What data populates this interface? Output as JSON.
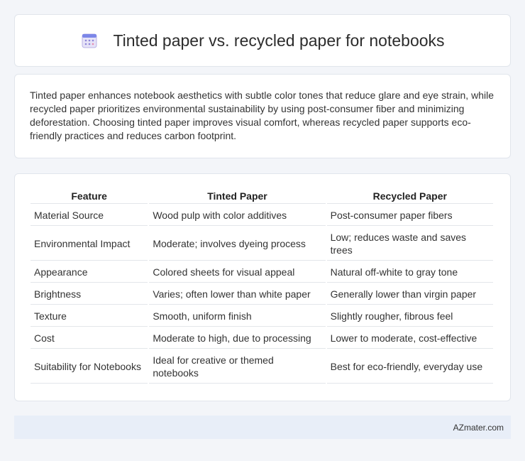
{
  "header": {
    "icon": "calendar-icon",
    "title": "Tinted paper vs. recycled paper for notebooks"
  },
  "intro": {
    "text": "Tinted paper enhances notebook aesthetics with subtle color tones that reduce glare and eye strain, while recycled paper prioritizes environmental sustainability by using post-consumer fiber and minimizing deforestation. Choosing tinted paper improves visual comfort, whereas recycled paper supports eco-friendly practices and reduces carbon footprint."
  },
  "table": {
    "headers": [
      "Feature",
      "Tinted Paper",
      "Recycled Paper"
    ],
    "rows": [
      [
        "Material Source",
        "Wood pulp with color additives",
        "Post-consumer paper fibers"
      ],
      [
        "Environmental Impact",
        "Moderate; involves dyeing process",
        "Low; reduces waste and saves trees"
      ],
      [
        "Appearance",
        "Colored sheets for visual appeal",
        "Natural off-white to gray tone"
      ],
      [
        "Brightness",
        "Varies; often lower than white paper",
        "Generally lower than virgin paper"
      ],
      [
        "Texture",
        "Smooth, uniform finish",
        "Slightly rougher, fibrous feel"
      ],
      [
        "Cost",
        "Moderate to high, due to processing",
        "Lower to moderate, cost-effective"
      ],
      [
        "Suitability for Notebooks",
        "Ideal for creative or themed notebooks",
        "Best for eco-friendly, everyday use"
      ]
    ]
  },
  "footer": {
    "text": "AZmater.com"
  }
}
